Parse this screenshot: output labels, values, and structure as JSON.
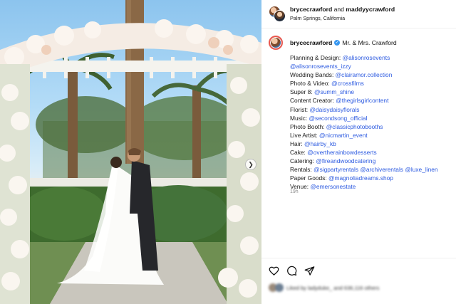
{
  "post": {
    "header": {
      "user1": "brycecrawford",
      "joiner": "and",
      "user2": "maddyycrawford",
      "location": "Palm Springs, California"
    },
    "caption": {
      "username": "brycecrawford",
      "title": "Mr. & Mrs. Crawford",
      "lines": [
        {
          "label": "Planning & Design: ",
          "tags": [
            "@alisonrosevents"
          ]
        },
        {
          "label": "",
          "tags": [
            "@alisonrosevents_izzy"
          ]
        },
        {
          "label": "Wedding Bands: ",
          "tags": [
            "@clairamor.collection"
          ]
        },
        {
          "label": "Photo & Video: ",
          "tags": [
            "@crossfilms"
          ]
        },
        {
          "label": "Super 8: ",
          "tags": [
            "@summ_shine"
          ]
        },
        {
          "label": "Content Creator: ",
          "tags": [
            "@thegirlsgirlcontent"
          ]
        },
        {
          "label": "Florist: ",
          "tags": [
            "@daisydaisyflorals"
          ]
        },
        {
          "label": "Music: ",
          "tags": [
            "@secondsong_official"
          ]
        },
        {
          "label": "Photo Booth: ",
          "tags": [
            "@classicphotobooths"
          ]
        },
        {
          "label": "Live Artist: ",
          "tags": [
            "@nicmartin_event"
          ]
        },
        {
          "label": "Hair: ",
          "tags": [
            "@hairby_kb"
          ]
        },
        {
          "label": "Cake: ",
          "tags": [
            "@overtherainbowdesserts"
          ]
        },
        {
          "label": "Catering: ",
          "tags": [
            "@fireandwoodcatering"
          ]
        },
        {
          "label": "Rentals: ",
          "tags": [
            "@sigpartyrentals",
            "@archiverentals",
            "@luxe_linen"
          ]
        },
        {
          "label": "Paper Goods: ",
          "tags": [
            "@magnoliadreams.shop"
          ]
        },
        {
          "label": "Venue: ",
          "tags": [
            "@emersonestate"
          ]
        }
      ],
      "time_ago": "19h"
    },
    "likes_text": "Liked by ladyduke_ and 636,116 others",
    "icons": {
      "like": "heart-icon",
      "comment": "comment-icon",
      "share": "send-icon",
      "verified": "verified-badge-icon",
      "next": "chevron-right-icon"
    },
    "colors": {
      "link": "#2c5ae0",
      "verified": "#3897f0",
      "story_ring": "#e95950",
      "meta": "#8e8e8e"
    }
  }
}
